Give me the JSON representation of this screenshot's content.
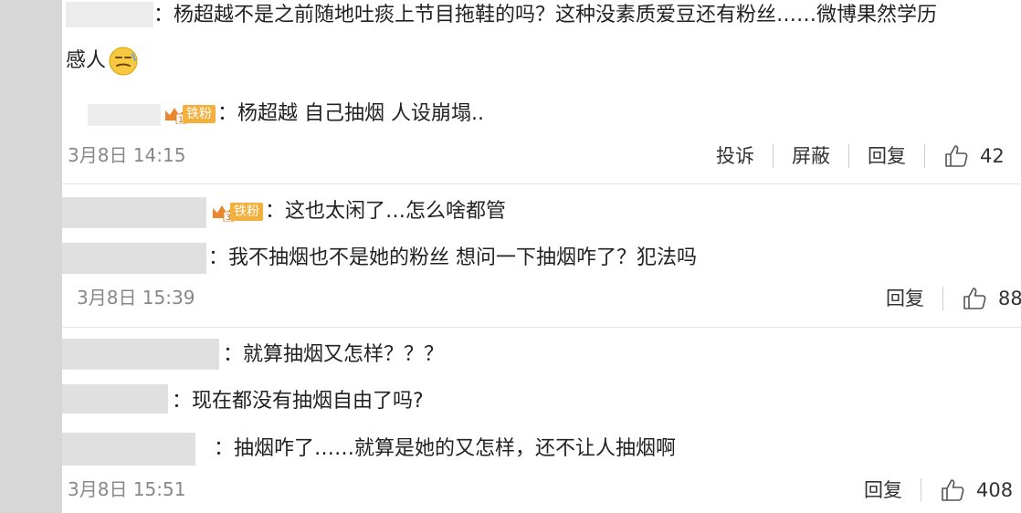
{
  "threads": [
    {
      "comments": [
        {
          "username": "",
          "text": "：杨超越不是之前随地吐痰上节目拖鞋的吗？这种没素质爱豆还有粉丝……微博果然学历",
          "continuation": "感人"
        },
        {
          "username": "",
          "fan_badge_level": "1",
          "fan_badge_label": "铁粉",
          "text": "：杨超越 自己抽烟 人设崩塌.."
        }
      ],
      "timestamp": "3月8日 14:15",
      "actions": {
        "report": "投诉",
        "block": "屏蔽",
        "reply": "回复",
        "likes": "42"
      }
    },
    {
      "comments": [
        {
          "username": "",
          "fan_badge_level": "3",
          "fan_badge_label": "铁粉",
          "text": "：这也太闲了…怎么啥都管"
        },
        {
          "username": "",
          "text": "：我不抽烟也不是她的粉丝 想问一下抽烟咋了？犯法吗"
        }
      ],
      "timestamp": "3月8日 15:39",
      "actions": {
        "reply": "回复",
        "likes": "88"
      }
    },
    {
      "comments": [
        {
          "username": "",
          "text": "：就算抽烟又怎样？？？"
        },
        {
          "username": "",
          "text": "：现在都没有抽烟自由了吗?"
        },
        {
          "username": "",
          "text": "：抽烟咋了……就算是她的又怎样，还不让人抽烟啊"
        }
      ],
      "timestamp": "3月8日 15:51",
      "actions": {
        "reply": "回复",
        "likes": "408"
      }
    }
  ],
  "colors": {
    "background": "#ffffff",
    "left_bar": "#d7d7d7",
    "badge": "#f3b03d",
    "meta_text": "#888888"
  },
  "icons": {
    "like": "thumbs-up-icon",
    "crown": "crown-icon",
    "emoji": "smirk-emoji-icon"
  }
}
